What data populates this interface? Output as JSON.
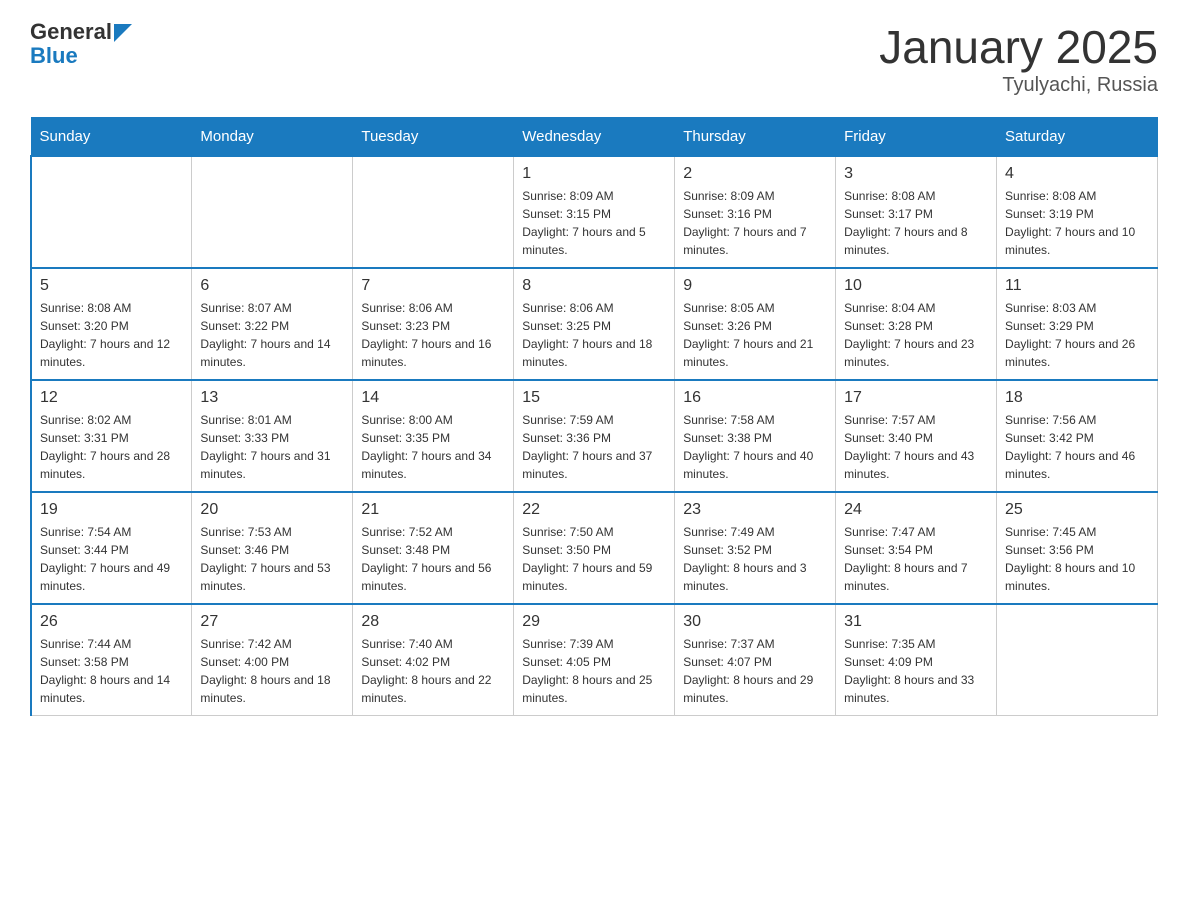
{
  "header": {
    "logo_text_general": "General",
    "logo_text_blue": "Blue",
    "title": "January 2025",
    "subtitle": "Tyulyachi, Russia"
  },
  "days_of_week": [
    "Sunday",
    "Monday",
    "Tuesday",
    "Wednesday",
    "Thursday",
    "Friday",
    "Saturday"
  ],
  "weeks": [
    [
      {
        "day": "",
        "info": ""
      },
      {
        "day": "",
        "info": ""
      },
      {
        "day": "",
        "info": ""
      },
      {
        "day": "1",
        "info": "Sunrise: 8:09 AM\nSunset: 3:15 PM\nDaylight: 7 hours and 5 minutes."
      },
      {
        "day": "2",
        "info": "Sunrise: 8:09 AM\nSunset: 3:16 PM\nDaylight: 7 hours and 7 minutes."
      },
      {
        "day": "3",
        "info": "Sunrise: 8:08 AM\nSunset: 3:17 PM\nDaylight: 7 hours and 8 minutes."
      },
      {
        "day": "4",
        "info": "Sunrise: 8:08 AM\nSunset: 3:19 PM\nDaylight: 7 hours and 10 minutes."
      }
    ],
    [
      {
        "day": "5",
        "info": "Sunrise: 8:08 AM\nSunset: 3:20 PM\nDaylight: 7 hours and 12 minutes."
      },
      {
        "day": "6",
        "info": "Sunrise: 8:07 AM\nSunset: 3:22 PM\nDaylight: 7 hours and 14 minutes."
      },
      {
        "day": "7",
        "info": "Sunrise: 8:06 AM\nSunset: 3:23 PM\nDaylight: 7 hours and 16 minutes."
      },
      {
        "day": "8",
        "info": "Sunrise: 8:06 AM\nSunset: 3:25 PM\nDaylight: 7 hours and 18 minutes."
      },
      {
        "day": "9",
        "info": "Sunrise: 8:05 AM\nSunset: 3:26 PM\nDaylight: 7 hours and 21 minutes."
      },
      {
        "day": "10",
        "info": "Sunrise: 8:04 AM\nSunset: 3:28 PM\nDaylight: 7 hours and 23 minutes."
      },
      {
        "day": "11",
        "info": "Sunrise: 8:03 AM\nSunset: 3:29 PM\nDaylight: 7 hours and 26 minutes."
      }
    ],
    [
      {
        "day": "12",
        "info": "Sunrise: 8:02 AM\nSunset: 3:31 PM\nDaylight: 7 hours and 28 minutes."
      },
      {
        "day": "13",
        "info": "Sunrise: 8:01 AM\nSunset: 3:33 PM\nDaylight: 7 hours and 31 minutes."
      },
      {
        "day": "14",
        "info": "Sunrise: 8:00 AM\nSunset: 3:35 PM\nDaylight: 7 hours and 34 minutes."
      },
      {
        "day": "15",
        "info": "Sunrise: 7:59 AM\nSunset: 3:36 PM\nDaylight: 7 hours and 37 minutes."
      },
      {
        "day": "16",
        "info": "Sunrise: 7:58 AM\nSunset: 3:38 PM\nDaylight: 7 hours and 40 minutes."
      },
      {
        "day": "17",
        "info": "Sunrise: 7:57 AM\nSunset: 3:40 PM\nDaylight: 7 hours and 43 minutes."
      },
      {
        "day": "18",
        "info": "Sunrise: 7:56 AM\nSunset: 3:42 PM\nDaylight: 7 hours and 46 minutes."
      }
    ],
    [
      {
        "day": "19",
        "info": "Sunrise: 7:54 AM\nSunset: 3:44 PM\nDaylight: 7 hours and 49 minutes."
      },
      {
        "day": "20",
        "info": "Sunrise: 7:53 AM\nSunset: 3:46 PM\nDaylight: 7 hours and 53 minutes."
      },
      {
        "day": "21",
        "info": "Sunrise: 7:52 AM\nSunset: 3:48 PM\nDaylight: 7 hours and 56 minutes."
      },
      {
        "day": "22",
        "info": "Sunrise: 7:50 AM\nSunset: 3:50 PM\nDaylight: 7 hours and 59 minutes."
      },
      {
        "day": "23",
        "info": "Sunrise: 7:49 AM\nSunset: 3:52 PM\nDaylight: 8 hours and 3 minutes."
      },
      {
        "day": "24",
        "info": "Sunrise: 7:47 AM\nSunset: 3:54 PM\nDaylight: 8 hours and 7 minutes."
      },
      {
        "day": "25",
        "info": "Sunrise: 7:45 AM\nSunset: 3:56 PM\nDaylight: 8 hours and 10 minutes."
      }
    ],
    [
      {
        "day": "26",
        "info": "Sunrise: 7:44 AM\nSunset: 3:58 PM\nDaylight: 8 hours and 14 minutes."
      },
      {
        "day": "27",
        "info": "Sunrise: 7:42 AM\nSunset: 4:00 PM\nDaylight: 8 hours and 18 minutes."
      },
      {
        "day": "28",
        "info": "Sunrise: 7:40 AM\nSunset: 4:02 PM\nDaylight: 8 hours and 22 minutes."
      },
      {
        "day": "29",
        "info": "Sunrise: 7:39 AM\nSunset: 4:05 PM\nDaylight: 8 hours and 25 minutes."
      },
      {
        "day": "30",
        "info": "Sunrise: 7:37 AM\nSunset: 4:07 PM\nDaylight: 8 hours and 29 minutes."
      },
      {
        "day": "31",
        "info": "Sunrise: 7:35 AM\nSunset: 4:09 PM\nDaylight: 8 hours and 33 minutes."
      },
      {
        "day": "",
        "info": ""
      }
    ]
  ]
}
